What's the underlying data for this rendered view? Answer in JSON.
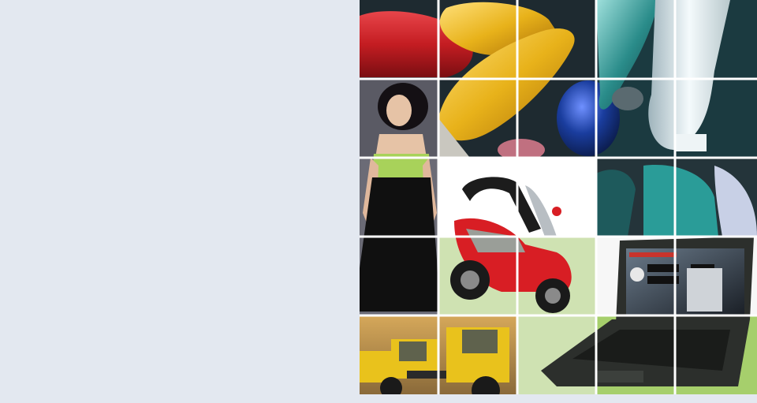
{
  "page": {
    "background": "#e3e8f0",
    "mosaic_grid_color": "#ffffff"
  },
  "mosaic": {
    "tiles": [
      {
        "name": "plastic-bottles-photo",
        "icon": "bottles-icon"
      },
      {
        "name": "fashion-model-photo",
        "icon": "person-icon"
      },
      {
        "name": "scooter-photo",
        "icon": "scooter-icon"
      },
      {
        "name": "laptop-software-photo",
        "icon": "laptop-icon"
      },
      {
        "name": "wheel-loaders-photo",
        "icon": "loader-icon"
      }
    ],
    "colors": {
      "bottle_red": "#c41d22",
      "bottle_yellow": "#e8b21a",
      "bottle_blue": "#1a3d9e",
      "bottle_teal": "#2a8c8a",
      "bottle_white": "#dfe8ec",
      "dress_black": "#101010",
      "dress_lime": "#a8d25a",
      "scooter_red": "#d81e24",
      "light_green": "#cfe2b2",
      "loader_yellow": "#e9c21c",
      "laptop_dark": "#2c2f2c"
    }
  }
}
